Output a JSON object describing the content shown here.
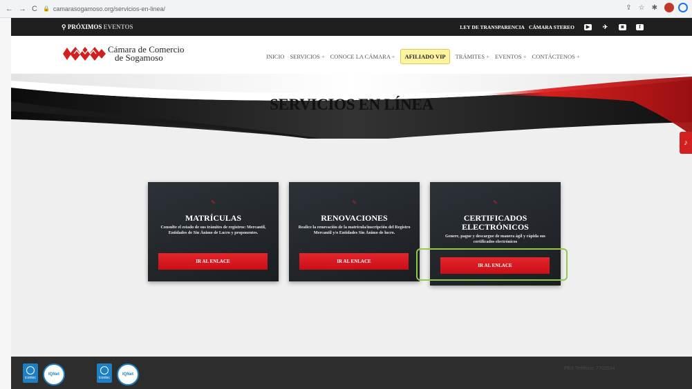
{
  "browser": {
    "url": "camarasogamoso.org/servicios-en-linea/"
  },
  "topbar": {
    "events_prefix": "PRÓXIMOS",
    "events_accent": "EVENTOS",
    "links": [
      "LEY DE TRANSPARENCIA",
      "CÁMARA STEREO"
    ]
  },
  "logo": {
    "line1": "Cámara de Comercio",
    "line2": "de Sogamoso"
  },
  "menu": {
    "items": [
      "INICIO",
      "SERVICIOS",
      "CONOCE LA CÁMARA",
      "AFILIADO VIP",
      "TRÁMITES",
      "EVENTOS",
      "CONTÁCTENOS"
    ],
    "plus": "+"
  },
  "banner": {
    "title": "SERVICIOS EN LÍNEA"
  },
  "cards": [
    {
      "title": "MATRÍCULAS",
      "desc": "Consulte el estado de sus trámites de registros: Mercantil, Entidades de Sin Ánimo de Lucro y proponentes.",
      "button": "IR AL ENLACE"
    },
    {
      "title": "RENOVACIONES",
      "desc": "Realice la renovación de la matrícula/inscripción del Registro Mercantil y/o Entidades Sin Ánimo de lucro.",
      "button": "IR AL ENLACE"
    },
    {
      "title_line1": "CERTIFICADOS",
      "title_line2": "ELECTRÓNICOS",
      "desc": "Genere, pague y descargue de manera ágil y rápida sus certificados electrónicos",
      "button": "IR AL ENLACE"
    }
  ],
  "footer": {
    "badge_label": "icontec",
    "iqnet_label": "IQNet",
    "pbx": "PBX Teléfono: 7702934"
  },
  "colors": {
    "accent_red": "#d71920",
    "highlight_green": "#92c94b",
    "vip_yellow": "#fdf3a0"
  }
}
